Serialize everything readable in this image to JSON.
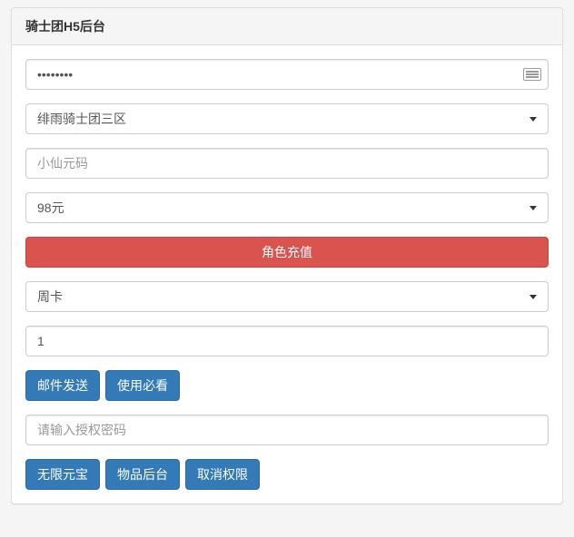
{
  "panel": {
    "title": "骑士团H5后台"
  },
  "form": {
    "password": {
      "value": "••••••••",
      "placeholder": ""
    },
    "server_select": {
      "value": "绯雨骑士团三区"
    },
    "role_input": {
      "value": "",
      "placeholder": "小仙元码"
    },
    "amount_select": {
      "value": "98元"
    },
    "recharge_button": "角色充值",
    "card_select": {
      "value": "周卡"
    },
    "quantity_input": {
      "value": "1"
    },
    "mail_send_button": "邮件发送",
    "usage_note_button": "使用必看",
    "auth_password_input": {
      "value": "",
      "placeholder": "请输入授权密码"
    },
    "unlimited_gold_button": "无限元宝",
    "item_backend_button": "物品后台",
    "revoke_permission_button": "取消权限"
  }
}
